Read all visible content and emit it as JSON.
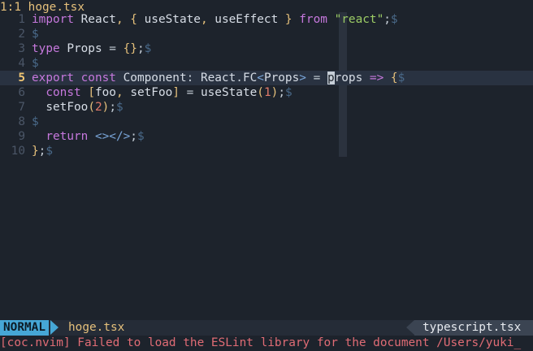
{
  "tabline": {
    "position": "1:1",
    "filename": "hoge.tsx"
  },
  "editor": {
    "cursor_line": 5,
    "lines": [
      {
        "num": "1"
      },
      {
        "num": "2"
      },
      {
        "num": "3"
      },
      {
        "num": "4"
      },
      {
        "num": "5"
      },
      {
        "num": "6"
      },
      {
        "num": "7"
      },
      {
        "num": "8"
      },
      {
        "num": "9"
      },
      {
        "num": "10"
      }
    ],
    "tokens": {
      "l1": [
        "import",
        " React",
        ",",
        " {",
        " useState",
        ",",
        " useEffect",
        " }",
        " from",
        " \"react\"",
        ";",
        "$"
      ],
      "l2": [
        "$"
      ],
      "l3": [
        "type",
        " Props",
        " =",
        " {}",
        ";",
        "$"
      ],
      "l4": [
        "$"
      ],
      "l5": [
        "export",
        " const",
        " Component",
        ":",
        " React",
        ".",
        "FC",
        "<",
        "Props",
        ">",
        " =",
        " ",
        "p",
        "rops",
        " =>",
        " {",
        "$"
      ],
      "l6": [
        "  const",
        " [",
        "foo",
        ",",
        " setFoo",
        "]",
        " =",
        " useState",
        "(",
        "1",
        ")",
        ";",
        "$"
      ],
      "l7": [
        "  setFoo",
        "(",
        "2",
        ")",
        ";",
        "$"
      ],
      "l8": [
        "$"
      ],
      "l9": [
        "  return",
        " <></>",
        ";",
        "$"
      ],
      "l10": [
        "}",
        ";",
        "$"
      ]
    }
  },
  "statusline": {
    "mode": "NORMAL",
    "filename": "hoge.tsx",
    "filetype": "typescript.tsx"
  },
  "message": "[coc.nvim] Failed to load the ESLint library for the document /Users/yuki_",
  "colors": {
    "background": "#1d232c",
    "mode_bg": "#46a7d6",
    "error": "#e06c75",
    "accent": "#e5c07b"
  }
}
